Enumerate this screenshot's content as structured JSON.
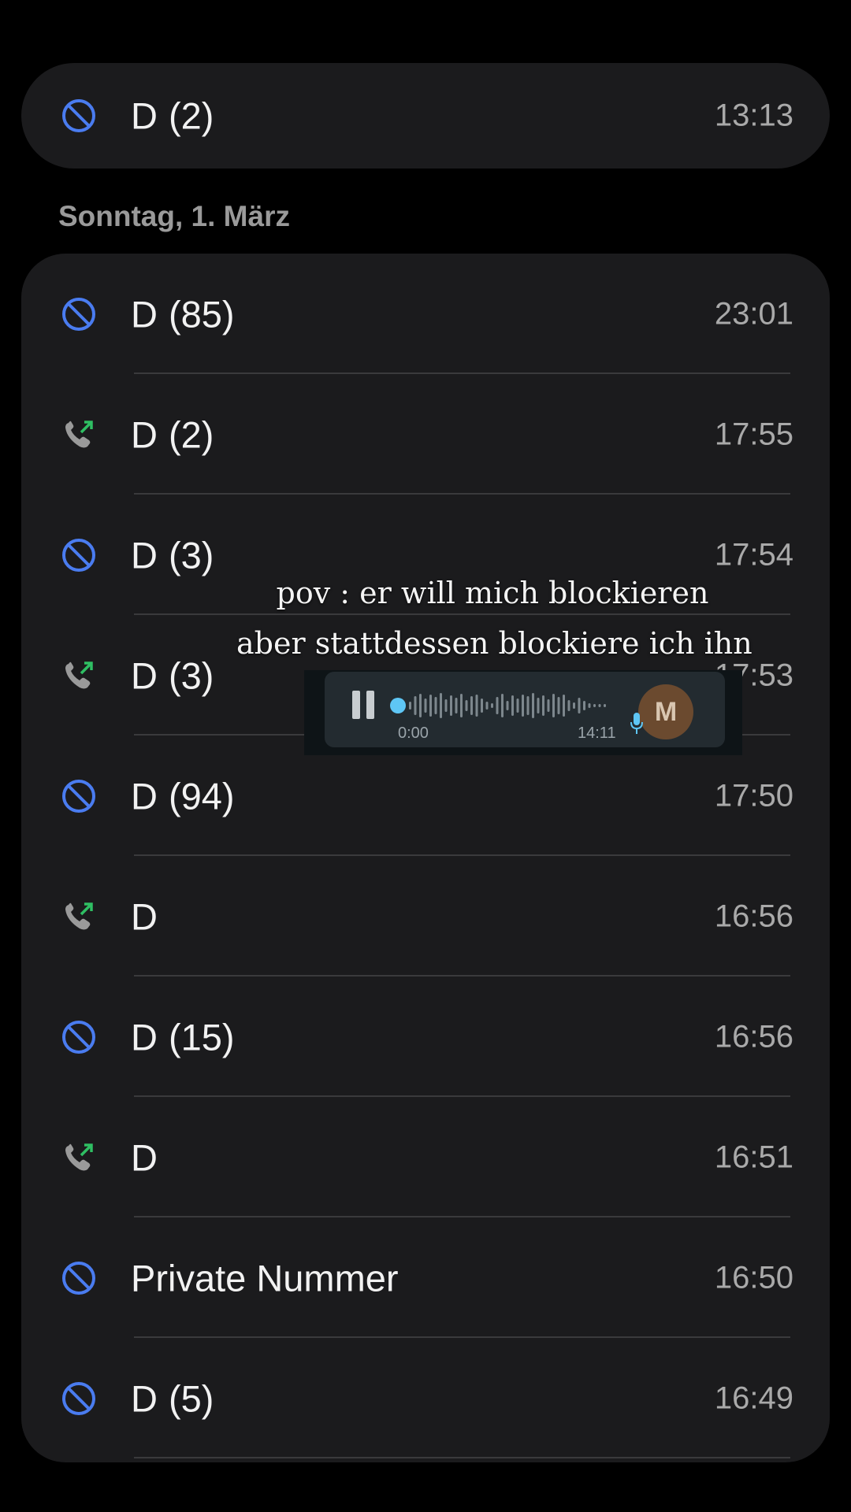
{
  "colors": {
    "background": "#000000",
    "card": "#1b1b1d",
    "blocked_icon": "#4a7cf0",
    "outgoing_arrow": "#2fbf63",
    "phone_gray": "#9a9a9a",
    "voice_accent": "#5ec6f5"
  },
  "top_entry": {
    "icon": "blocked-icon",
    "name": "D",
    "count": "(2)",
    "time": "13:13"
  },
  "section": {
    "date_label": "Sonntag, 1. März"
  },
  "calls": [
    {
      "icon": "blocked-icon",
      "name": "D",
      "count": "(85)",
      "time": "23:01"
    },
    {
      "icon": "outgoing-call-icon",
      "name": "D",
      "count": "(2)",
      "time": "17:55"
    },
    {
      "icon": "blocked-icon",
      "name": "D",
      "count": "(3)",
      "time": "17:54"
    },
    {
      "icon": "outgoing-call-icon",
      "name": "D",
      "count": "(3)",
      "time": "17:53"
    },
    {
      "icon": "blocked-icon",
      "name": "D",
      "count": "(94)",
      "time": "17:50"
    },
    {
      "icon": "outgoing-call-icon",
      "name": "D",
      "count": "",
      "time": "16:56"
    },
    {
      "icon": "blocked-icon",
      "name": "D",
      "count": "(15)",
      "time": "16:56"
    },
    {
      "icon": "outgoing-call-icon",
      "name": "D",
      "count": "",
      "time": "16:51"
    },
    {
      "icon": "blocked-icon",
      "name": "Private Nummer",
      "count": "",
      "time": "16:50"
    },
    {
      "icon": "blocked-icon",
      "name": "D",
      "count": "(5)",
      "time": "16:49"
    }
  ],
  "overlay": {
    "line1": "pov : er will mich blockieren",
    "line2": "aber stattdessen blockiere ich ihn"
  },
  "voice_message": {
    "current_time": "0:00",
    "duration": "14:11",
    "avatar_letter": "M",
    "progress": 0
  }
}
